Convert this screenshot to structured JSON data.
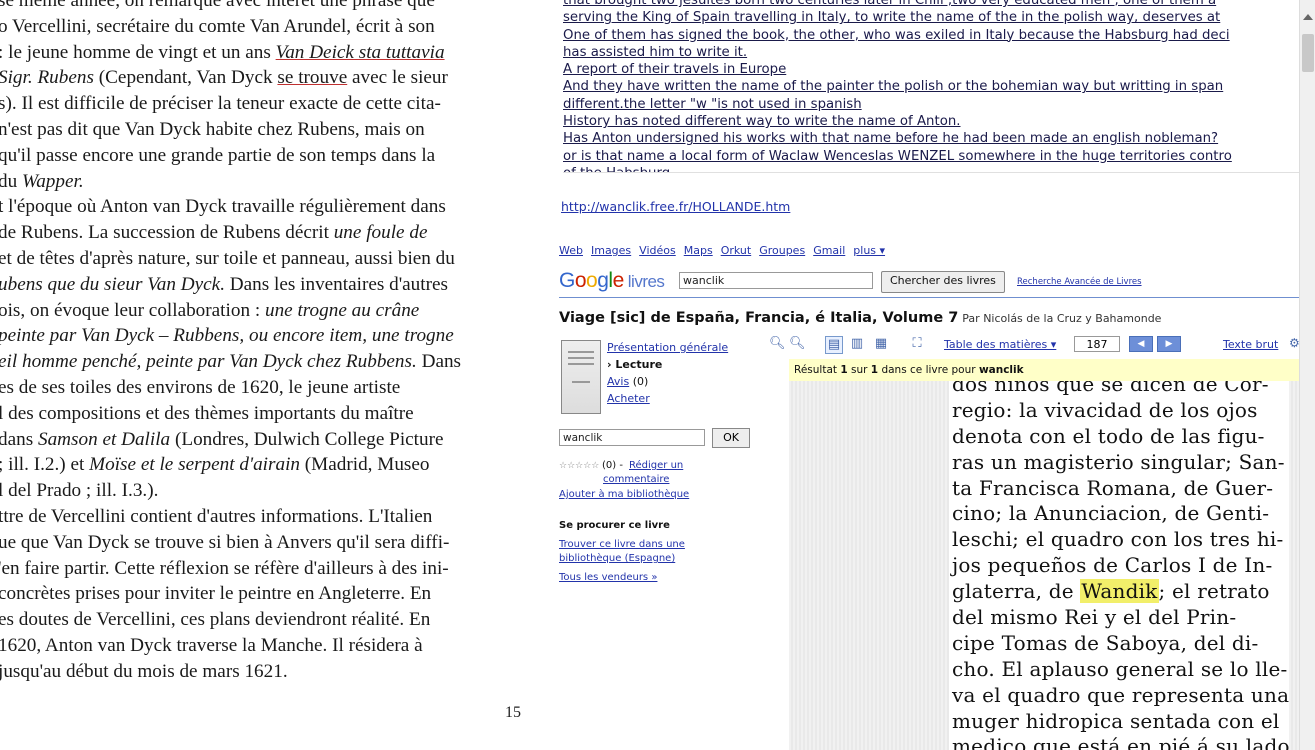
{
  "book_page": {
    "lines": [
      "se même année, on remarque avec intérêt une phrase que",
      "o Vercellini, secrétaire du comte Van Arundel, écrit à son",
      ": le jeune homme de vingt et un ans |Van Deick sta tuttavia|",
      "Sigr. Rubens| (Cependant, Van Dyck |se trouve| avec le sieur",
      "s). Il est difficile de préciser la teneur exacte de cette cita-",
      " n'est pas dit que Van Dyck habite chez Rubens, mais on",
      " qu'il passe encore une grande partie de son temps dans la",
      " du |Wapper.|",
      "t l'époque où Anton van Dyck travaille régulièrement dans",
      " de Rubens. La succession de Rubens décrit |une foule de|",
      "et de têtes d'après nature, sur toile et panneau, aussi bien du",
      "ubens que du sieur Van Dyck.| Dans les inventaires d'autres",
      "ois, on évoque leur collaboration : |une trogne au crâne|",
      " peinte par Van Dyck – Rubbens, ou encore item, une trogne",
      "eil homme penché, peinte par Van Dyck chez Rubbens.| Dans",
      "es de ses toiles des environs de 1620, le jeune artiste",
      "l des compositions et des thèmes importants du maître",
      " dans |Samson et Dalila| (Londres, Dulwich College Picture",
      " ; ill. I.2.) et |Moïse et le serpent d'airain| (Madrid, Museo",
      "l del Prado ; ill. I.3.).",
      "ttre de Vercellini contient d'autres informations. L'Italien",
      "ue que Van Dyck se trouve si bien à Anvers qu'il sera diffi-",
      "'en faire partir. Cette réflexion se réfère d'ailleurs à des ini-",
      "concrètes prises pour inviter le peintre en Angleterre. En",
      "es doutes de Vercellini, ces plans deviendront réalité. En",
      " 1620, Anton van Dyck traverse la Manche. Il résidera à",
      " jusqu'au début du mois de mars 1621."
    ],
    "page_number": "15"
  },
  "forum_lines": [
    "that brought two jesuites born two centuries later in Chili ,two very educated men , one of them a",
    "serving the King of Spain  travelling in Italy, to write the name of the in the polish way, deserves at",
    "One of them has signed the book, the other, who was exiled in Italy because the Habsburg had deci",
    " has assisted him to write it.",
    "A report  of their travels in Europe",
    "And they have written  the name of the painter the polish or the bohemian way but writting in span",
    "different.the letter \"w \"is not used in spanish",
    "History has noted different way to write the name of Anton.",
    "Has Anton undersigned his works with that name before he had been made an english nobleman?",
    "or is that name a local form of Waclaw Wenceslas WENZEL somewhere in the huge territories contro",
    "of the Habsburg ..."
  ],
  "reference_link": "http://wanclik.free.fr/HOLLANDE.htm",
  "google_books": {
    "top_nav": [
      "Web",
      "Images",
      "Vidéos",
      "Maps",
      "Orkut",
      "Groupes",
      "Gmail",
      "plus ▾"
    ],
    "logo_text": "Google",
    "logo_suffix": "livres",
    "search_value": "wanclik",
    "search_button": "Chercher des livres",
    "advanced_link": "Recherche Avancée de Livres",
    "book_title": "Viage [sic] de España, Francia, é Italia, Volume 7",
    "book_author": "Par Nicolás de la Cruz y Bahamonde",
    "sidebar": {
      "overview": "Présentation générale",
      "reading": "› Lecture",
      "reviews": "Avis",
      "reviews_count": "(0)",
      "buy": "Acheter",
      "search_value": "wanclik",
      "ok_button": "OK",
      "rating_count": "(0) -",
      "write_review": "Rédiger un",
      "write_review_2": "commentaire",
      "add_library": "Ajouter à ma bibliothèque",
      "get_book_heading": "Se procurer ce livre",
      "find_library": "Trouver ce livre dans une",
      "find_library_2": "bibliothèque (Espagne)",
      "all_sellers": "Tous les vendeurs »"
    },
    "toolbar": {
      "toc": "Table des matières ▾",
      "page_value": "187",
      "prev": "◀",
      "next": "▶",
      "plain_text": "Texte brut",
      "more": "⚙"
    },
    "result_prefix": "Résultat",
    "result_num": "1",
    "result_mid": "sur",
    "result_total": "1",
    "result_suffix": "dans ce livre pour",
    "result_term": "wanclik",
    "scan_lines": [
      "dos niños que se dicen de Cor-",
      "regio: la vivacidad de los ojos",
      "denota con el todo de las figu-",
      "ras un magisterio singular; San-",
      "ta Francisca Romana, de Guer-",
      "cino; la Anunciacion, de Genti-",
      "leschi; el quadro con los tres hi-",
      "jos pequeños de Carlos I de In-",
      "glaterra, de |Wandik|; el retrato",
      "del mismo Rei y el del Prin-",
      "cipe Tomas de Saboya, del di-",
      "cho. El aplauso general se lo lle-",
      "va el quadro que representa una",
      "muger hidropica sentada con el",
      "medico que está en pié á su lado"
    ]
  },
  "colors": {
    "link": "#2233aa",
    "highlight": "#f2ef6a",
    "result_bar": "#ffffc8",
    "nav_button": "#6d8fd8"
  }
}
